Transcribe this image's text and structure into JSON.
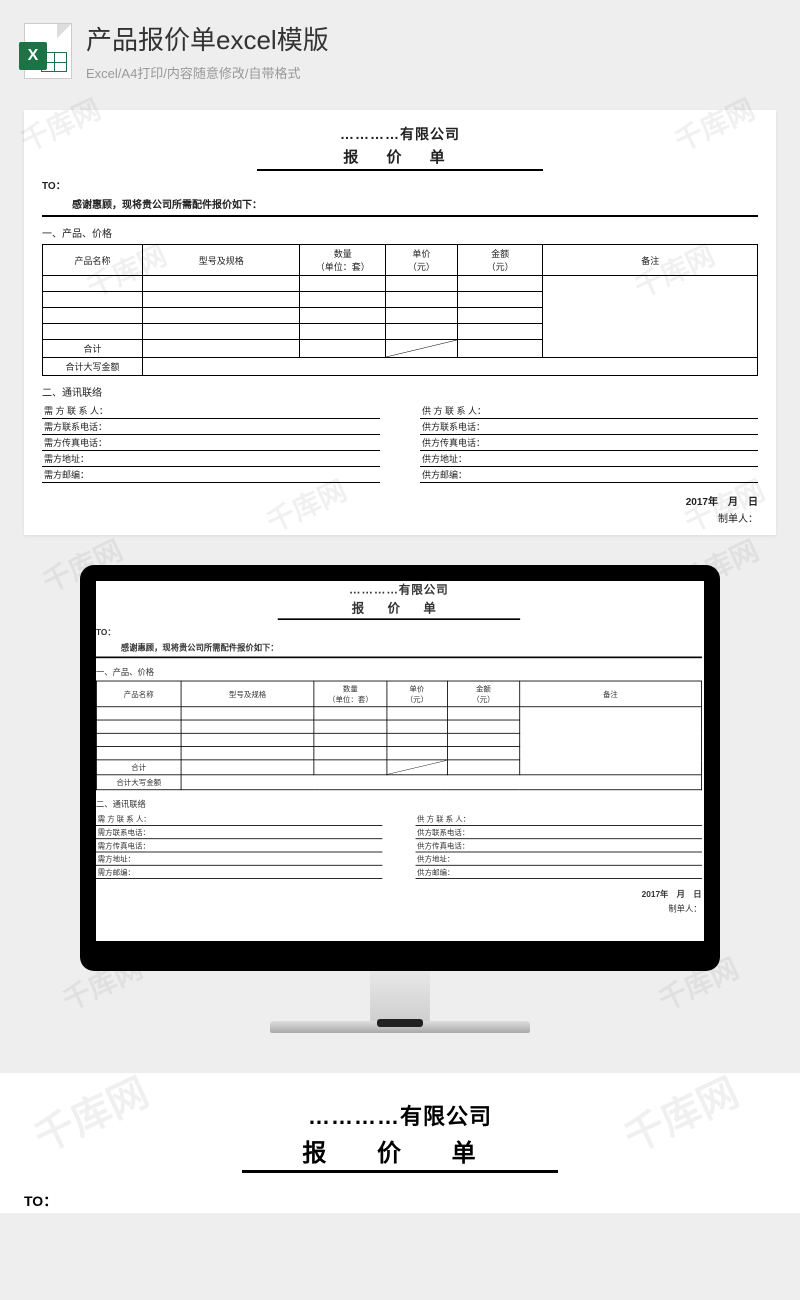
{
  "header": {
    "title": "产品报价单excel模版",
    "subtitle": "Excel/A4打印/内容随意修改/自带格式",
    "icon_letter": "X"
  },
  "watermark": "千库网",
  "doc": {
    "company": "…………有限公司",
    "title": "报 价 单",
    "to_label": "TO：",
    "thanks": "感谢惠顾，现将贵公司所需配件报价如下：",
    "section1": "一、产品、价格",
    "table_headers": {
      "name": "产品名称",
      "model": "型号及规格",
      "qty": "数量\n（单位：套）",
      "price": "单价\n（元）",
      "amount": "金额\n（元）",
      "remark": "备注"
    },
    "total_label": "合计",
    "total_cn_label": "合计大写金额",
    "section2": "二、通讯联络",
    "buyer": {
      "contact": "需 方 联 系 人：",
      "phone": "需方联系电话：",
      "fax": "需方传真电话：",
      "address": "需方地址：",
      "zip": "需方邮编："
    },
    "supplier": {
      "contact": "供 方 联 系 人：",
      "phone": "供方联系电话：",
      "fax": "供方传真电话：",
      "address": "供方地址：",
      "zip": "供方邮编："
    },
    "date": "2017年　月　日",
    "maker": "制单人："
  }
}
